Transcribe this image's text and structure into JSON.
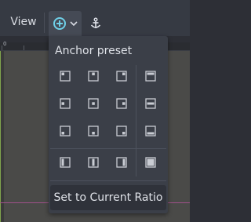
{
  "toolbar": {
    "view_label": "View",
    "anchor_toggle_icon": "anchor-preset-icon",
    "anchor_icon": "anchor-icon"
  },
  "ruler": {
    "zero_label": "0"
  },
  "popup": {
    "title": "Anchor preset",
    "set_ratio_label": "Set to Current Ratio",
    "presets": [
      "top-left",
      "center-top",
      "top-right",
      "top-wide",
      "center-left",
      "center",
      "center-right",
      "hcenter-wide",
      "bottom-left",
      "center-bottom",
      "bottom-right",
      "bottom-wide",
      "left-wide",
      "vcenter-wide",
      "right-wide",
      "full-rect"
    ]
  },
  "colors": {
    "accent": "#7ec8e3",
    "toolbar_bg": "#363a43",
    "popup_bg": "#3b3f48"
  }
}
